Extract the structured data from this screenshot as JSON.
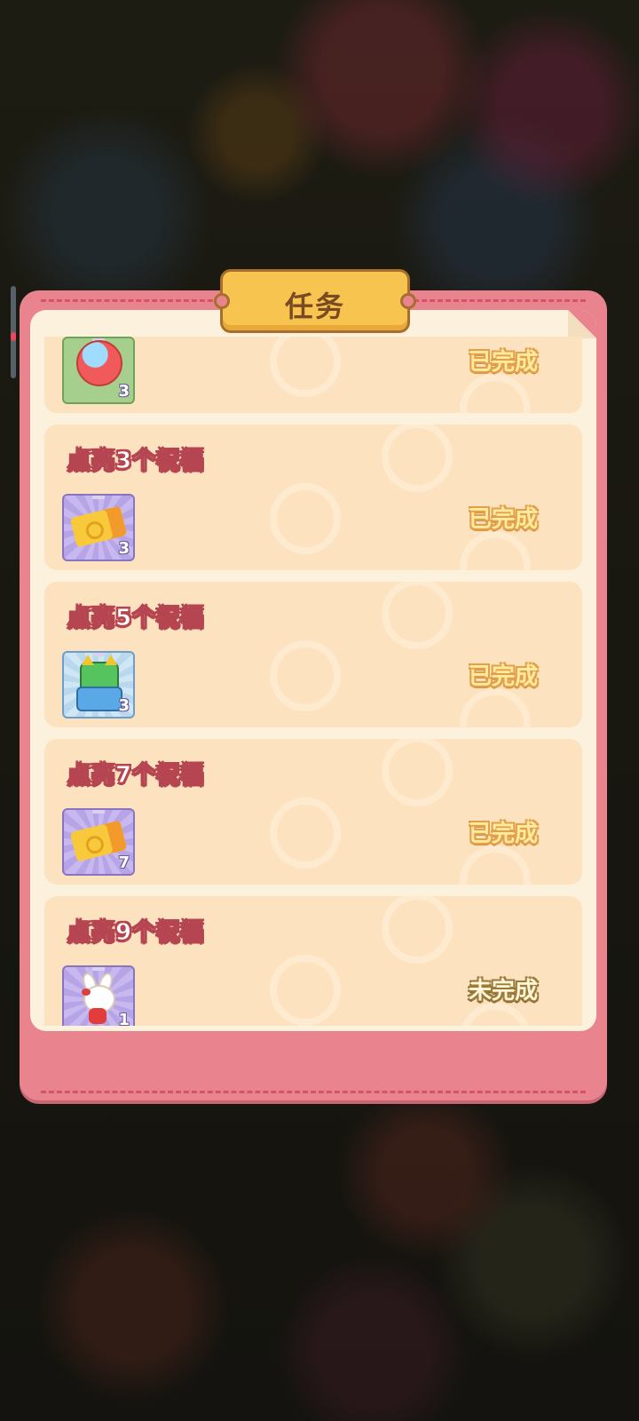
{
  "panel": {
    "title": "任务",
    "tasks": [
      {
        "title": "",
        "reward_icon": "red-orb-icon",
        "reward_qty": "3",
        "status": "已完成",
        "done": true
      },
      {
        "title": "点亮3个祝福",
        "reward_icon": "ticket-icon",
        "reward_qty": "3",
        "status": "已完成",
        "done": true
      },
      {
        "title": "点亮5个祝福",
        "reward_icon": "green-robot-icon",
        "reward_qty": "3",
        "status": "已完成",
        "done": true
      },
      {
        "title": "点亮7个祝福",
        "reward_icon": "ticket-icon",
        "reward_qty": "7",
        "status": "已完成",
        "done": true
      },
      {
        "title": "点亮9个祝福",
        "reward_icon": "bunny-character-icon",
        "reward_qty": "1",
        "status": "未完成",
        "done": false
      }
    ]
  },
  "colors": {
    "panel_pink": "#e9848f",
    "inner_cream": "#fbf1dc",
    "card": "#fde2bf",
    "banner_gold": "#f6c44f",
    "done_text": "#ffeaa0",
    "todo_text": "#fff6d8"
  }
}
